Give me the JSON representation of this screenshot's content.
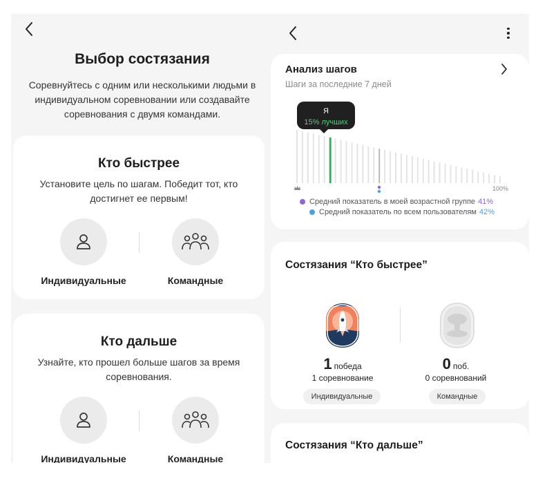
{
  "left": {
    "title": "Выбор состязания",
    "description": "Соревнуйтесь с одним или несколькими людьми в индивидуальном соревновании или создавайте соревнования с двумя командами.",
    "faster": {
      "title": "Кто быстрее",
      "description": "Установите цель по шагам. Победит тот, кто достигнет ее первым!",
      "individual_label": "Индивидуальные",
      "team_label": "Командные"
    },
    "farther": {
      "title": "Кто дальше",
      "description": "Узнайте, кто прошел больше шагов за время соревнования.",
      "individual_label": "Индивидуальные",
      "team_label": "Командные"
    }
  },
  "right": {
    "analysis": {
      "title": "Анализ шагов",
      "subtitle": "Шаги за последние 7 дней"
    },
    "chart_data": {
      "type": "bar",
      "bar_count": 38,
      "me_position_percent": 15,
      "tooltip_label": "Я",
      "tooltip_value": "15% лучших",
      "scale_end_label": "100%",
      "highlight_color": "#2db55d",
      "bar_color": "#e4e4e4",
      "legend": [
        {
          "label": "Средний показатель в моей возрастной группе",
          "value": "41%",
          "color": "#8e63e0"
        },
        {
          "label": "Средний показатель по всем пользователям",
          "value": "42%",
          "color": "#4aa3ea"
        }
      ]
    },
    "faster_stats": {
      "title": "Состязания “Кто быстрее”",
      "individual": {
        "number": "1",
        "unit": "победа",
        "count": "1 соревнование",
        "chip": "Индивидуальные"
      },
      "team": {
        "number": "0",
        "unit": "поб.",
        "count": "0 соревнований",
        "chip": "Командные"
      }
    },
    "farther_stats": {
      "title": "Состязания “Кто дальше”"
    }
  }
}
